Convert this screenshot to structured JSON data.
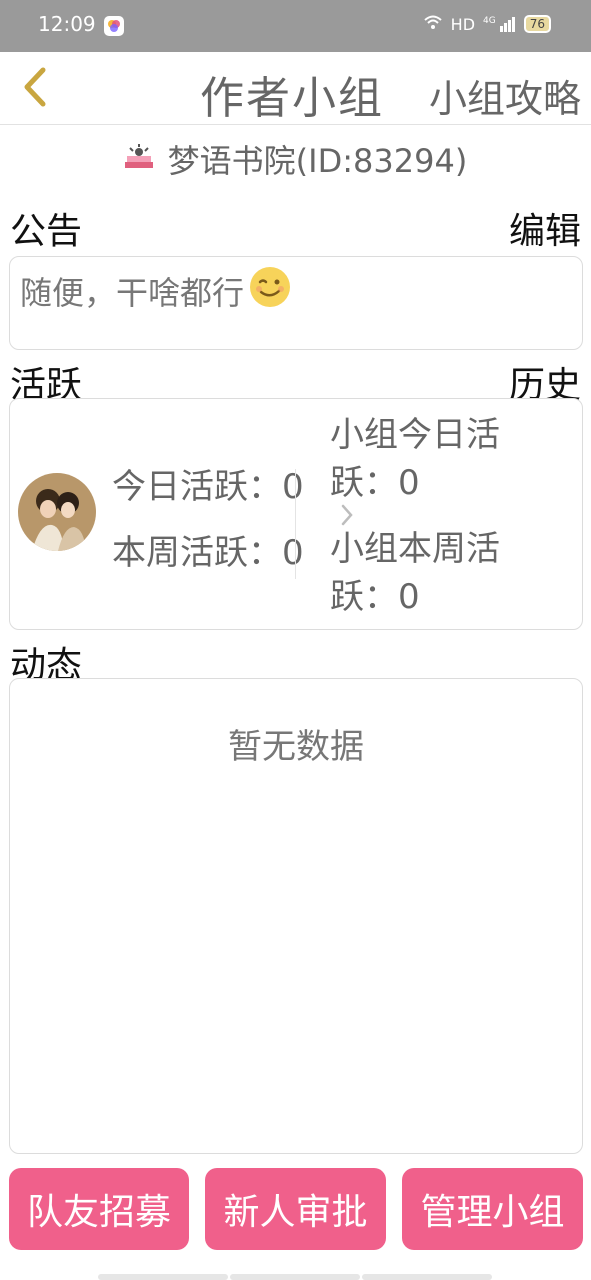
{
  "status_bar": {
    "time": "12:09",
    "network": "HD",
    "signal": "4G",
    "battery": "76"
  },
  "header": {
    "title": "作者小组",
    "right_link": "小组攻略"
  },
  "group": {
    "name": "梦语书院(ID:83294)"
  },
  "notice": {
    "label": "公告",
    "action": "编辑",
    "text": "随便，干啥都行"
  },
  "activity": {
    "label": "活跃",
    "action": "历史",
    "today": "今日活跃：0",
    "week": "本周活跃：0",
    "group_today_line1": "小组今日活",
    "group_today_line2": "跃：0",
    "group_week_line1": "小组本周活",
    "group_week_line2": "跃：0"
  },
  "feed": {
    "label": "动态",
    "empty": "暂无数据"
  },
  "buttons": {
    "recruit": "队友招募",
    "approve": "新人审批",
    "manage": "管理小组"
  },
  "colors": {
    "primary": "#f0608b",
    "status_bar": "#9a9a9a"
  }
}
